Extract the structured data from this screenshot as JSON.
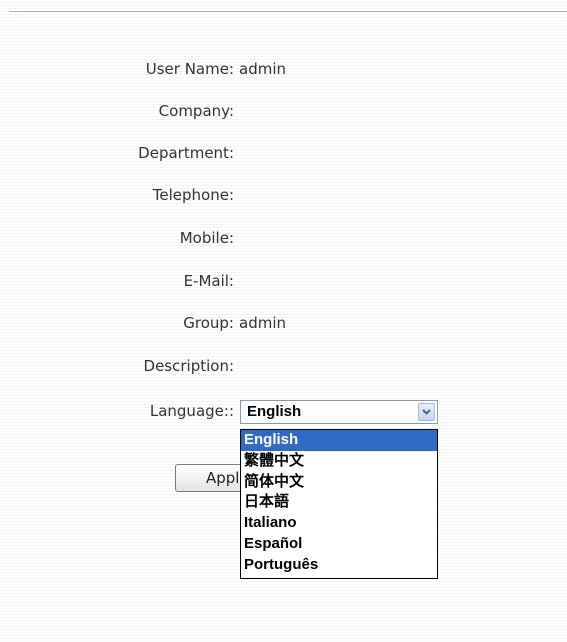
{
  "profile": {
    "user_name_label": "User Name:",
    "user_name_value": "admin",
    "company_label": "Company:",
    "company_value": "",
    "department_label": "Department:",
    "department_value": "",
    "telephone_label": "Telephone:",
    "telephone_value": "",
    "mobile_label": "Mobile:",
    "mobile_value": "",
    "email_label": "E-Mail:",
    "email_value": "",
    "group_label": "Group:",
    "group_value": "admin",
    "description_label": "Description:",
    "description_value": "",
    "language_label": "Language::"
  },
  "language_select": {
    "selected": "English",
    "options": [
      "English",
      "繁體中文",
      "简体中文",
      "日本語",
      "Italiano",
      "Español",
      "Português"
    ],
    "highlight_color": "#316ac5"
  },
  "actions": {
    "apply_label": "Apply"
  },
  "icons": {
    "select_arrow": "chevron-down-icon"
  }
}
